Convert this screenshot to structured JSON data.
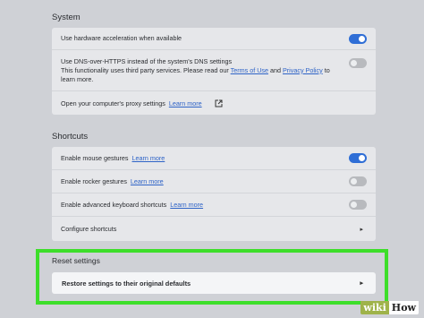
{
  "system": {
    "title": "System",
    "hardware_accel": {
      "label": "Use hardware acceleration when available",
      "enabled": true
    },
    "dns": {
      "line1": "Use DNS-over-HTTPS instead of the system's DNS settings",
      "line2_prefix": "This functionality uses third party services. Please read our",
      "terms_link": "Terms of Use",
      "and": "and",
      "privacy_link": "Privacy Policy",
      "line2_suffix": "to",
      "line3": "learn more.",
      "enabled": false
    },
    "proxy": {
      "label": "Open your computer's proxy settings",
      "link": "Learn more",
      "icon": "external-link-icon"
    }
  },
  "shortcuts": {
    "title": "Shortcuts",
    "mouse_gestures": {
      "label": "Enable mouse gestures",
      "link": "Learn more",
      "enabled": true
    },
    "rocker_gestures": {
      "label": "Enable rocker gestures",
      "link": "Learn more",
      "enabled": false
    },
    "keyboard_shortcuts": {
      "label": "Enable advanced keyboard shortcuts",
      "link": "Learn more",
      "enabled": false
    },
    "configure": {
      "label": "Configure shortcuts",
      "icon": "chevron-right-icon"
    }
  },
  "reset": {
    "title": "Reset settings",
    "restore_label": "Restore settings to their original defaults",
    "icon": "chevron-right-icon"
  },
  "watermark": {
    "wiki": "wiki",
    "how": "How"
  },
  "colors": {
    "toggle_on": "#2f6ed6",
    "toggle_off": "#b8babe",
    "link": "#2e63c7",
    "highlight": "#3dde2a",
    "background": "#cfd1d6"
  }
}
